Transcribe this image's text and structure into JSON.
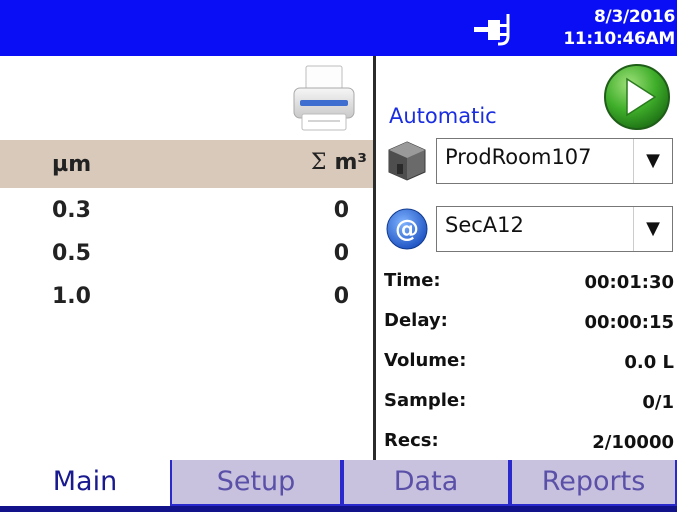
{
  "header": {
    "date": "8/3/2016",
    "time": "11:10:46AM",
    "status_icon": "plug-icon",
    "colors": {
      "bar": "#0a0ef4",
      "text": "#ffffff"
    }
  },
  "counts": {
    "columns": {
      "size_unit": "µm",
      "sum_symbol": "Σ",
      "sum_unit": "m³"
    },
    "rows": [
      {
        "size": "0.3",
        "count": "0"
      },
      {
        "size": "0.5",
        "count": "0"
      },
      {
        "size": "1.0",
        "count": "0"
      }
    ]
  },
  "controls": {
    "mode": "Automatic",
    "location": {
      "value": "ProdRoom107",
      "icon": "room-cube-icon"
    },
    "section": {
      "value": "SecA12",
      "icon": "at-sign-icon"
    }
  },
  "stats": [
    {
      "label": "Time:",
      "value": "00:01:30"
    },
    {
      "label": "Delay:",
      "value": "00:00:15"
    },
    {
      "label": "Volume:",
      "value": "0.0 L"
    },
    {
      "label": "Sample:",
      "value": "0/1"
    },
    {
      "label": "Recs:",
      "value": "2/10000"
    }
  ],
  "tabs": [
    {
      "label": "Main",
      "active": true
    },
    {
      "label": "Setup",
      "active": false
    },
    {
      "label": "Data",
      "active": false
    },
    {
      "label": "Reports",
      "active": false
    }
  ]
}
